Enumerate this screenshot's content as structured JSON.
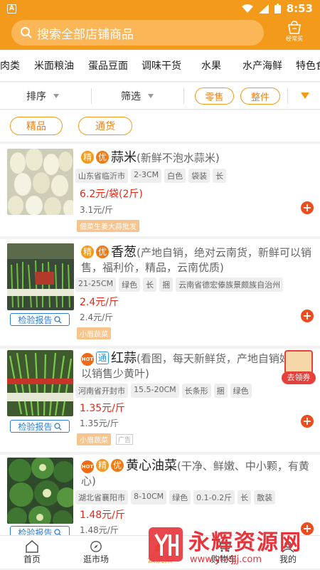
{
  "status": {
    "app_letter": "A",
    "time": "8:53"
  },
  "search": {
    "placeholder": "搜索全部店铺商品",
    "basket_label": "经常买"
  },
  "categories": [
    "肉类",
    "米面粮油",
    "蛋品豆面",
    "调味干货",
    "水果",
    "水产海鲜",
    "特色食"
  ],
  "filters": {
    "sort": "排序",
    "filter": "筛选",
    "retail": "零售",
    "whole": "整件"
  },
  "grades": [
    "精品",
    "通货"
  ],
  "products": [
    {
      "badges": [
        "精",
        "优"
      ],
      "name": "蒜米",
      "desc": "(新鲜不泡水蒜米)",
      "tags": [
        "山东省临沂市",
        "2-3CM",
        "白色",
        "袋装",
        "长"
      ],
      "price": "6.2元/袋(2斤)",
      "unit_price": "3.1元/斤",
      "shop": "佃菜生姜大蒜批发",
      "report": ""
    },
    {
      "badges": [
        "精",
        "优"
      ],
      "name": "香葱",
      "desc": "(产地自销，绝对云南货，新鲜可以销售，福利价，精品，云南优质)",
      "tags": [
        "21-25CM",
        "绿色",
        "长",
        "捆",
        "云南省德宏傣族景颇族自治州"
      ],
      "price": "2.4元/斤",
      "unit_price": "2.4元/斤",
      "shop": "小眉蔬菜",
      "report": "检验报告"
    },
    {
      "badges": [
        "HOT",
        "通"
      ],
      "name": "红蒜",
      "desc": "(看图，每天新鲜货，产地自销好，可以销售少黄叶)",
      "tags": [
        "河南省开封市",
        "15.5-20CM",
        "长条形",
        "捆",
        "绿色"
      ],
      "price": "1.35元/斤",
      "unit_price": "1.35元/斤",
      "shop": "小眉蔬菜",
      "ad": "广告",
      "report": "检验报告"
    },
    {
      "badges": [
        "HOT",
        "精",
        "优"
      ],
      "name": "黄心油菜",
      "desc": "(干净、鲜嫩、中小颗，有黄心)",
      "tags": [
        "湖北省襄阳市",
        "8-10CM",
        "绿色",
        "0.1-0.2斤",
        "长",
        "散装"
      ],
      "price": "1.48元/斤",
      "unit_price": "1.48元/斤",
      "shop": "",
      "report": "检验报告"
    }
  ],
  "coupon": {
    "label": "去领券"
  },
  "tabbar": [
    "首页",
    "逛市场",
    "云洗菜",
    "购物车",
    "我的"
  ],
  "watermark": {
    "text": "永辉资源网",
    "url": "www.yhkjjj.com"
  }
}
